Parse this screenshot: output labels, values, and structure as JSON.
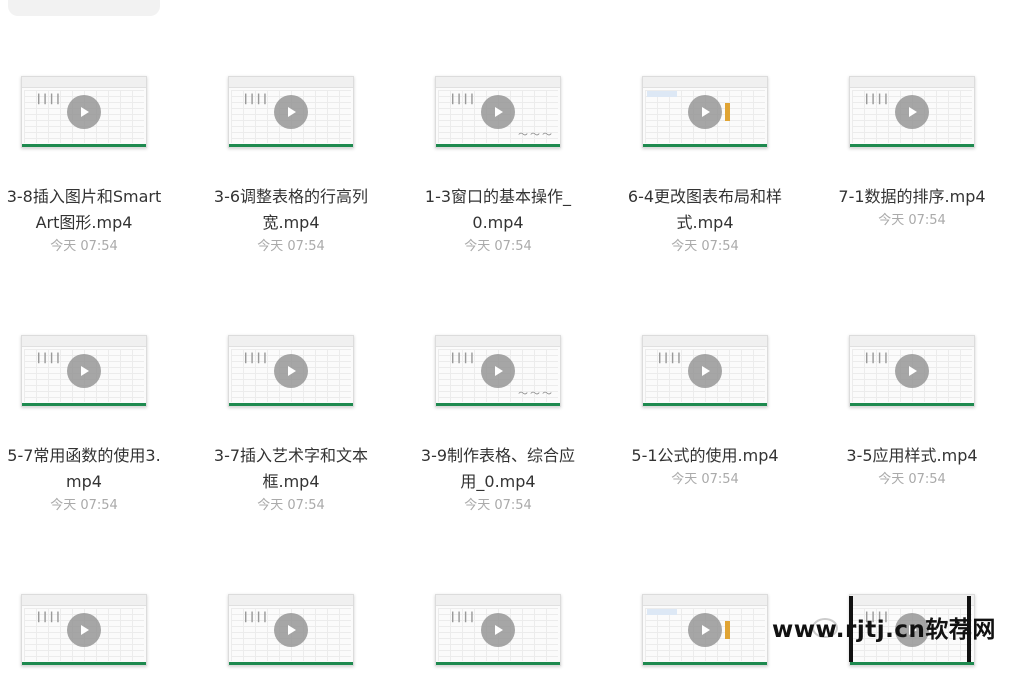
{
  "files": [
    {
      "name": "3-8插入图片和SmartArt图形.mp4",
      "time": "今天 07:54",
      "thumb": "plain"
    },
    {
      "name": "3-6调整表格的行高列宽.mp4",
      "time": "今天 07:54",
      "thumb": "plain"
    },
    {
      "name": "1-3窗口的基本操作_0.mp4",
      "time": "今天 07:54",
      "thumb": "scribble"
    },
    {
      "name": "6-4更改图表布局和样式.mp4",
      "time": "今天 07:54",
      "thumb": "chart"
    },
    {
      "name": "7-1数据的排序.mp4",
      "time": "今天 07:54",
      "thumb": "plain"
    },
    {
      "name": "5-7常用函数的使用3.mp4",
      "time": "今天 07:54",
      "thumb": "plain"
    },
    {
      "name": "3-7插入艺术字和文本框.mp4",
      "time": "今天 07:54",
      "thumb": "plain"
    },
    {
      "name": "3-9制作表格、综合应用_0.mp4",
      "time": "今天 07:54",
      "thumb": "scribble"
    },
    {
      "name": "5-1公式的使用.mp4",
      "time": "今天 07:54",
      "thumb": "plain"
    },
    {
      "name": "3-5应用样式.mp4",
      "time": "今天 07:54",
      "thumb": "plain"
    },
    {
      "name": "",
      "time": "",
      "thumb": "plain"
    },
    {
      "name": "",
      "time": "",
      "thumb": "plain"
    },
    {
      "name": "",
      "time": "",
      "thumb": "plain"
    },
    {
      "name": "",
      "time": "",
      "thumb": "chart"
    },
    {
      "name": "",
      "time": "",
      "thumb": "plain"
    }
  ],
  "watermark": "www.rjtj.cn软荐网",
  "icons": {
    "play": "play-icon",
    "thumbnail": "spreadsheet-thumbnail"
  },
  "colors": {
    "play_bg": "#969696",
    "name_text": "#333333",
    "time_text": "#aaaaaa",
    "sheet_green": "#1e8a4f",
    "chart_orange": "#e0a434"
  }
}
